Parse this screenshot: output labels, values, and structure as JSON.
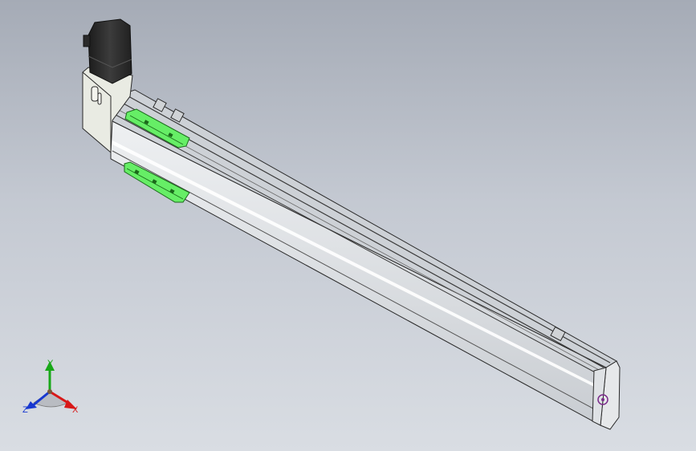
{
  "viewport": {
    "background_top": "#a5abb6",
    "background_bottom": "#d9dde3"
  },
  "model": {
    "housing_color": "#e4e7ea",
    "rail_color": "#c6cbd1",
    "motor_color": "#2b2b2b",
    "selected_color": "#66ee66"
  },
  "triad": {
    "x_label": "X",
    "y_label": "Y",
    "z_label": "Z",
    "x_color": "#d81818",
    "y_color": "#18a818",
    "z_color": "#1838d0"
  }
}
